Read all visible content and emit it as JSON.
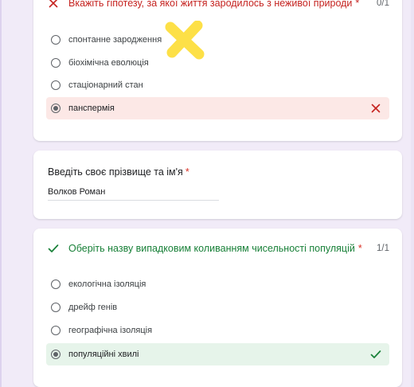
{
  "colors": {
    "background": "#f1ebf8",
    "incorrect": "#c5221f",
    "correct": "#188038",
    "incorrect_bg": "#fce8e6",
    "correct_bg": "#e6f4ea",
    "highlight": "#fde047"
  },
  "question1": {
    "status_icon": "close-icon",
    "title": "Вкажіть гіпотезу, за якої життя зародилось з неживої природи",
    "required_mark": "*",
    "score": "0/1",
    "options": [
      {
        "label": "спонтанне зародження",
        "selected": false
      },
      {
        "label": "біохімічна еволюція",
        "selected": false
      },
      {
        "label": "стаціонарний стан",
        "selected": false
      },
      {
        "label": "панспермія",
        "selected": true,
        "result_icon": "close-icon"
      }
    ]
  },
  "name_question": {
    "title": "Введіть своє прізвище та ім'я",
    "required_mark": "*",
    "value": "Волков Роман"
  },
  "question2": {
    "status_icon": "check-icon",
    "title": "Оберіть назву випадковим коливанням чисельності популяцій",
    "required_mark": "*",
    "score": "1/1",
    "options": [
      {
        "label": "екологічна ізоляція",
        "selected": false
      },
      {
        "label": "дрейф генів",
        "selected": false
      },
      {
        "label": "географічна ізоляція",
        "selected": false
      },
      {
        "label": "популяційні хвилі",
        "selected": true,
        "result_icon": "check-icon"
      }
    ]
  }
}
